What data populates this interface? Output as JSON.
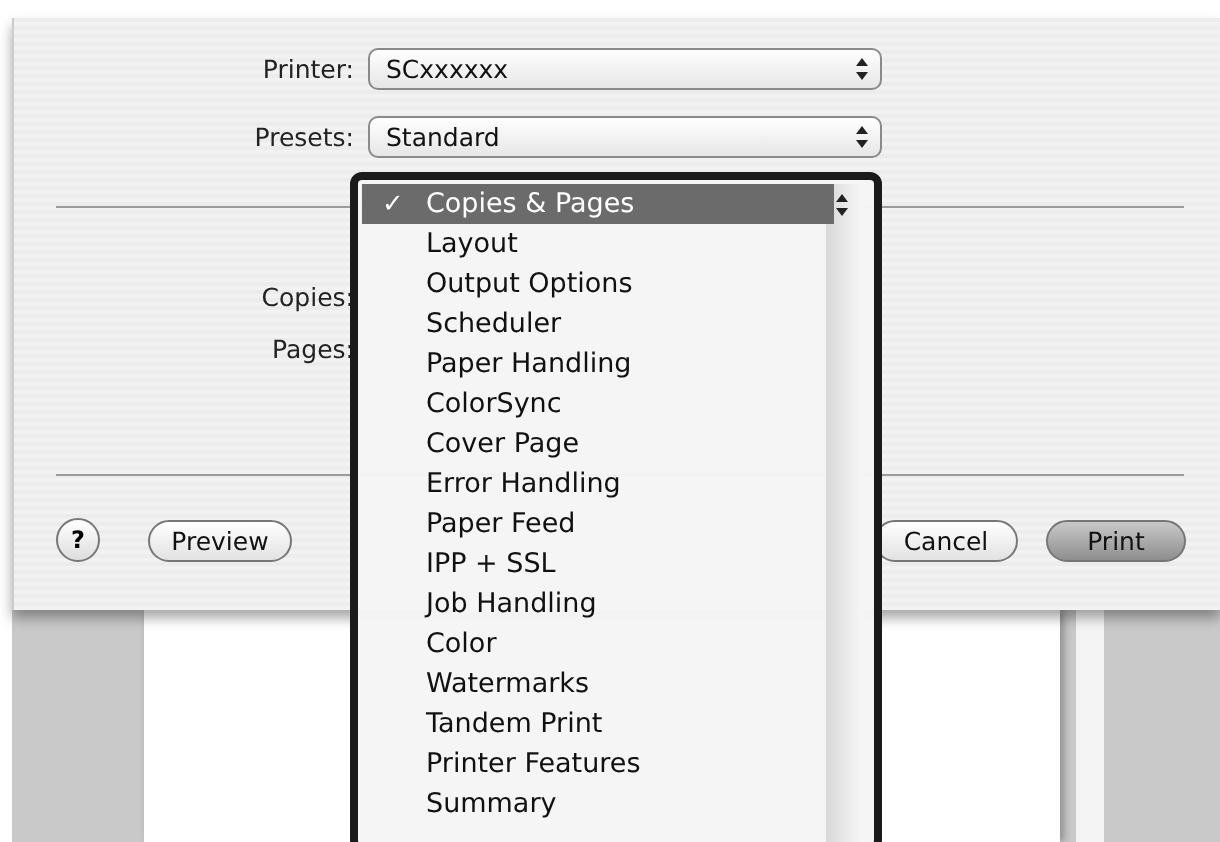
{
  "printer": {
    "label": "Printer:",
    "value": "SCxxxxxx"
  },
  "presets": {
    "label": "Presets:",
    "value": "Standard"
  },
  "fields": [
    {
      "label": "Copies:"
    },
    {
      "label": "Pages:"
    }
  ],
  "buttons": {
    "help": "?",
    "preview": "Preview",
    "cancel": "Cancel",
    "print": "Print"
  },
  "menu": {
    "items": [
      {
        "label": "Copies & Pages",
        "selected": true,
        "check": "✓"
      },
      {
        "label": "Layout",
        "selected": false
      },
      {
        "label": "Output Options",
        "selected": false
      },
      {
        "label": "Scheduler",
        "selected": false
      },
      {
        "label": "Paper Handling",
        "selected": false
      },
      {
        "label": "ColorSync",
        "selected": false
      },
      {
        "label": "Cover Page",
        "selected": false
      },
      {
        "label": "Error Handling",
        "selected": false
      },
      {
        "label": "Paper Feed",
        "selected": false
      },
      {
        "label": "IPP + SSL",
        "selected": false
      },
      {
        "label": "Job Handling",
        "selected": false
      },
      {
        "label": "Color",
        "selected": false
      },
      {
        "label": "Watermarks",
        "selected": false
      },
      {
        "label": "Tandem Print",
        "selected": false
      },
      {
        "label": "Printer Features",
        "selected": false
      },
      {
        "label": "Summary",
        "selected": false
      }
    ]
  }
}
